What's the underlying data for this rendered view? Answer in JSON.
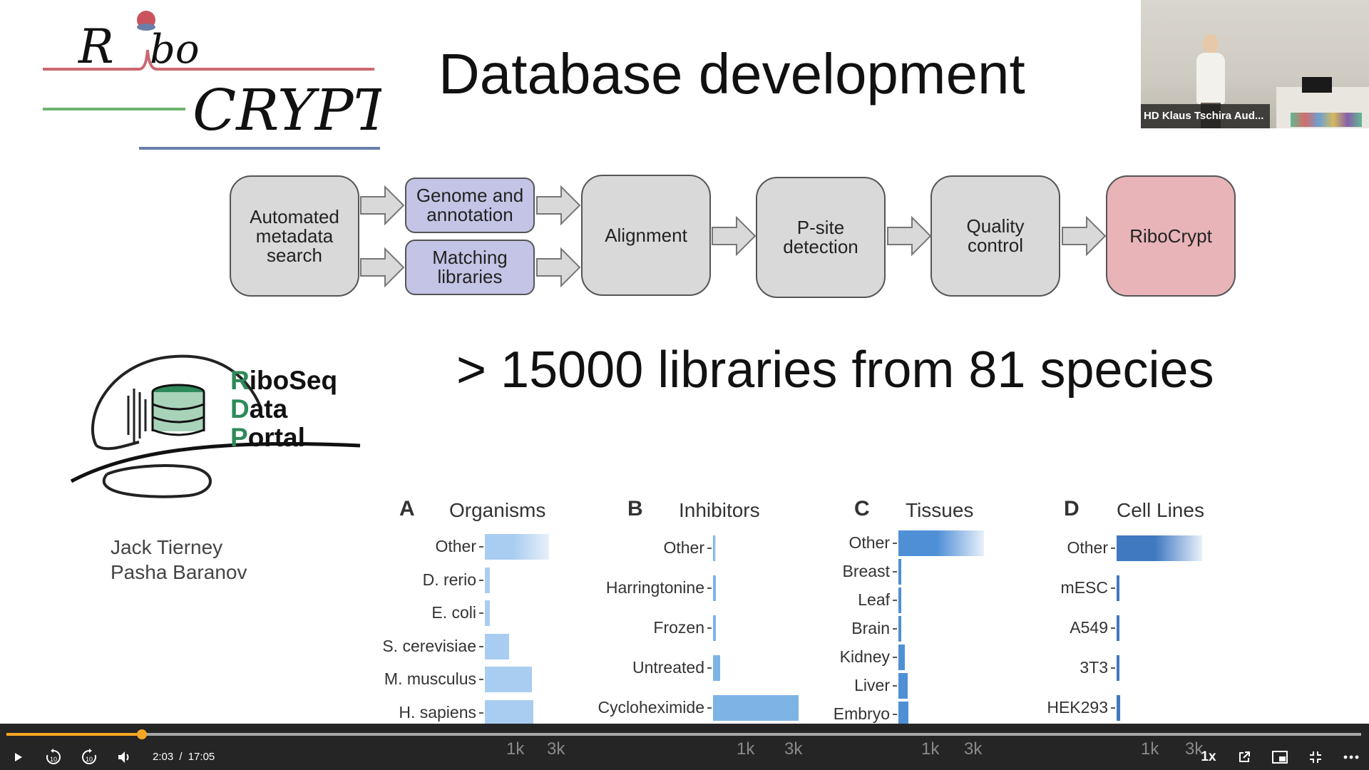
{
  "slide": {
    "title": "Database development",
    "stat": "> 15000 libraries from 81 species",
    "authors": [
      "Jack Tierney",
      "Pasha Baranov"
    ],
    "portal_name": [
      {
        "initial": "R",
        "rest": "iboSeq"
      },
      {
        "initial": "D",
        "rest": "ata"
      },
      {
        "initial": "P",
        "rest": "ortal"
      }
    ],
    "logo_text": "RiboCRYPT"
  },
  "pipeline": {
    "steps": [
      {
        "id": "metadata",
        "label": "Automated\nmetadata\nsearch",
        "color": "#d9d9d9"
      },
      {
        "id": "genome",
        "label": "Genome and\nannotation",
        "color": "#c4c4e6"
      },
      {
        "id": "matching",
        "label": "Matching\nlibraries",
        "color": "#c4c4e6"
      },
      {
        "id": "alignment",
        "label": "Alignment",
        "color": "#d9d9d9"
      },
      {
        "id": "psite",
        "label": "P-site\ndetection",
        "color": "#d9d9d9"
      },
      {
        "id": "qc",
        "label": "Quality\ncontrol",
        "color": "#d9d9d9"
      },
      {
        "id": "ribocrypt",
        "label": "RiboCrypt",
        "color": "#e8b4b8"
      }
    ]
  },
  "webcam": {
    "label": "HD Klaus Tschira Aud..."
  },
  "chart_data": [
    {
      "type": "bar",
      "panel": "A",
      "title": "Organisms",
      "categories": [
        "Other",
        "D. rerio",
        "E. coli",
        "S. cerevisiae",
        "M. musculus",
        "H. sapiens"
      ],
      "values": [
        4500,
        350,
        350,
        1700,
        3300,
        3400
      ],
      "x_ticks": [
        "1k",
        "3k"
      ]
    },
    {
      "type": "bar",
      "panel": "B",
      "title": "Inhibitors",
      "categories": [
        "Other",
        "Harringtonine",
        "Frozen",
        "Untreated",
        "Cycloheximide"
      ],
      "values": [
        80,
        80,
        120,
        300,
        3500
      ],
      "x_ticks": [
        "1k",
        "3k"
      ]
    },
    {
      "type": "bar",
      "panel": "C",
      "title": "Tissues",
      "categories": [
        "Other",
        "Breast",
        "Leaf",
        "Brain",
        "Kidney",
        "Liver",
        "Embryo"
      ],
      "values": [
        6000,
        150,
        150,
        150,
        450,
        650,
        700
      ],
      "x_ticks": [
        "1k",
        "3k"
      ]
    },
    {
      "type": "bar",
      "panel": "D",
      "title": "Cell Lines",
      "categories": [
        "Other",
        "mESC",
        "A549",
        "3T3",
        "HEK293"
      ],
      "values": [
        7000,
        40,
        60,
        60,
        300
      ],
      "x_ticks": [
        "1k",
        "3k"
      ]
    }
  ],
  "player": {
    "current_time": "2:03",
    "separator": "/",
    "duration": "17:05",
    "progress_fraction": 0.1,
    "speed": "1x",
    "icons": [
      "play-icon",
      "rewind-10-icon",
      "forward-10-icon",
      "volume-icon",
      "popout-icon",
      "picture-in-picture-icon",
      "exit-fullscreen-icon",
      "more-icon"
    ],
    "accent": "#f5a623"
  }
}
